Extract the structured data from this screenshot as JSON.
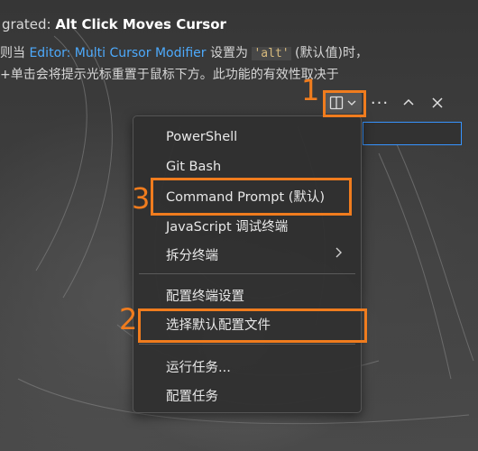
{
  "setting": {
    "title_prefix": "grated: ",
    "title_bold": "Alt Click Moves Cursor",
    "line1_pre": " 则当 ",
    "line1_link": "Editor: Multi Cursor Modifier",
    "line1_mid": " 设置为 ",
    "line1_code": "'alt'",
    "line1_post": " (默认值)时，",
    "line2": "+单击会将提示光标重置于鼠标下方。此功能的有效性取决于"
  },
  "toolbar": {
    "split_icon": "split-terminal-icon",
    "dropdown_icon": "chevron-down-icon",
    "more_label": "···",
    "up_icon": "chevron-up-icon",
    "close_icon": "close-icon"
  },
  "menu": {
    "items": [
      {
        "label": "PowerShell"
      },
      {
        "label": "Git Bash"
      },
      {
        "label": "Command Prompt (默认)"
      },
      {
        "label": "JavaScript 调试终端"
      },
      {
        "label": "拆分终端"
      },
      {
        "label": "配置终端设置"
      },
      {
        "label": "选择默认配置文件"
      },
      {
        "label": "运行任务..."
      },
      {
        "label": "配置任务"
      }
    ]
  },
  "annotations": {
    "one": "1",
    "two": "2",
    "three": "3",
    "color": "#f07c1e"
  }
}
